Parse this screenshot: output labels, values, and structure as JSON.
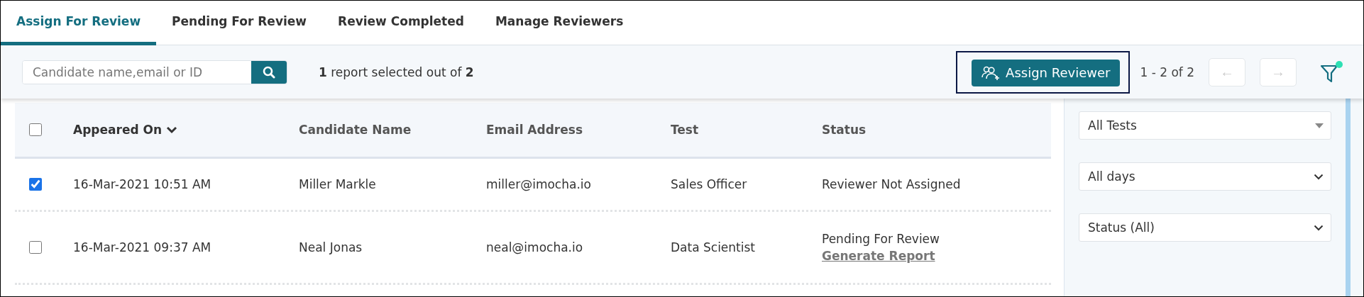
{
  "tabs": [
    {
      "label": "Assign For Review",
      "selected": true
    },
    {
      "label": "Pending For Review",
      "selected": false
    },
    {
      "label": "Review Completed",
      "selected": false
    },
    {
      "label": "Manage Reviewers",
      "selected": false
    }
  ],
  "toolbar": {
    "search": {
      "placeholder": "Candidate name,email or ID"
    },
    "selection_summary": "**1** report selected out of **2**",
    "assign_button": "Assign Reviewer",
    "range": "1 - 2 of 2",
    "pager": [
      {
        "label": "←",
        "disabled": true
      },
      {
        "label": "→",
        "disabled": true
      }
    ],
    "filter": {
      "active": true
    }
  },
  "table": {
    "select_all": {
      "checked": false
    },
    "columns": [
      {
        "label": "Appeared On",
        "sorted": true
      },
      {
        "label": "Candidate Name",
        "sorted": false
      },
      {
        "label": "Email Address",
        "sorted": false
      },
      {
        "label": "Test",
        "sorted": false
      },
      {
        "label": "Status",
        "sorted": false
      }
    ],
    "rows": [
      {
        "checked": true,
        "appeared_on": "16-Mar-2021 10:51 AM",
        "candidate_name": "Miller Markle",
        "email": "miller@imocha.io",
        "test": "Sales Officer",
        "status": "Reviewer Not Assigned"
      },
      {
        "checked": false,
        "appeared_on": "16-Mar-2021 09:37 AM",
        "candidate_name": "Neal Jonas",
        "email": "neal@imocha.io",
        "test": "Data Scientist",
        "status": "Pending For Review",
        "link": "Generate Report"
      }
    ]
  },
  "filters": [
    {
      "value": "All Tests",
      "kind": "triangle"
    },
    {
      "value": "All days",
      "kind": "chevron"
    },
    {
      "value": "Status (All)",
      "kind": "chevron"
    }
  ]
}
